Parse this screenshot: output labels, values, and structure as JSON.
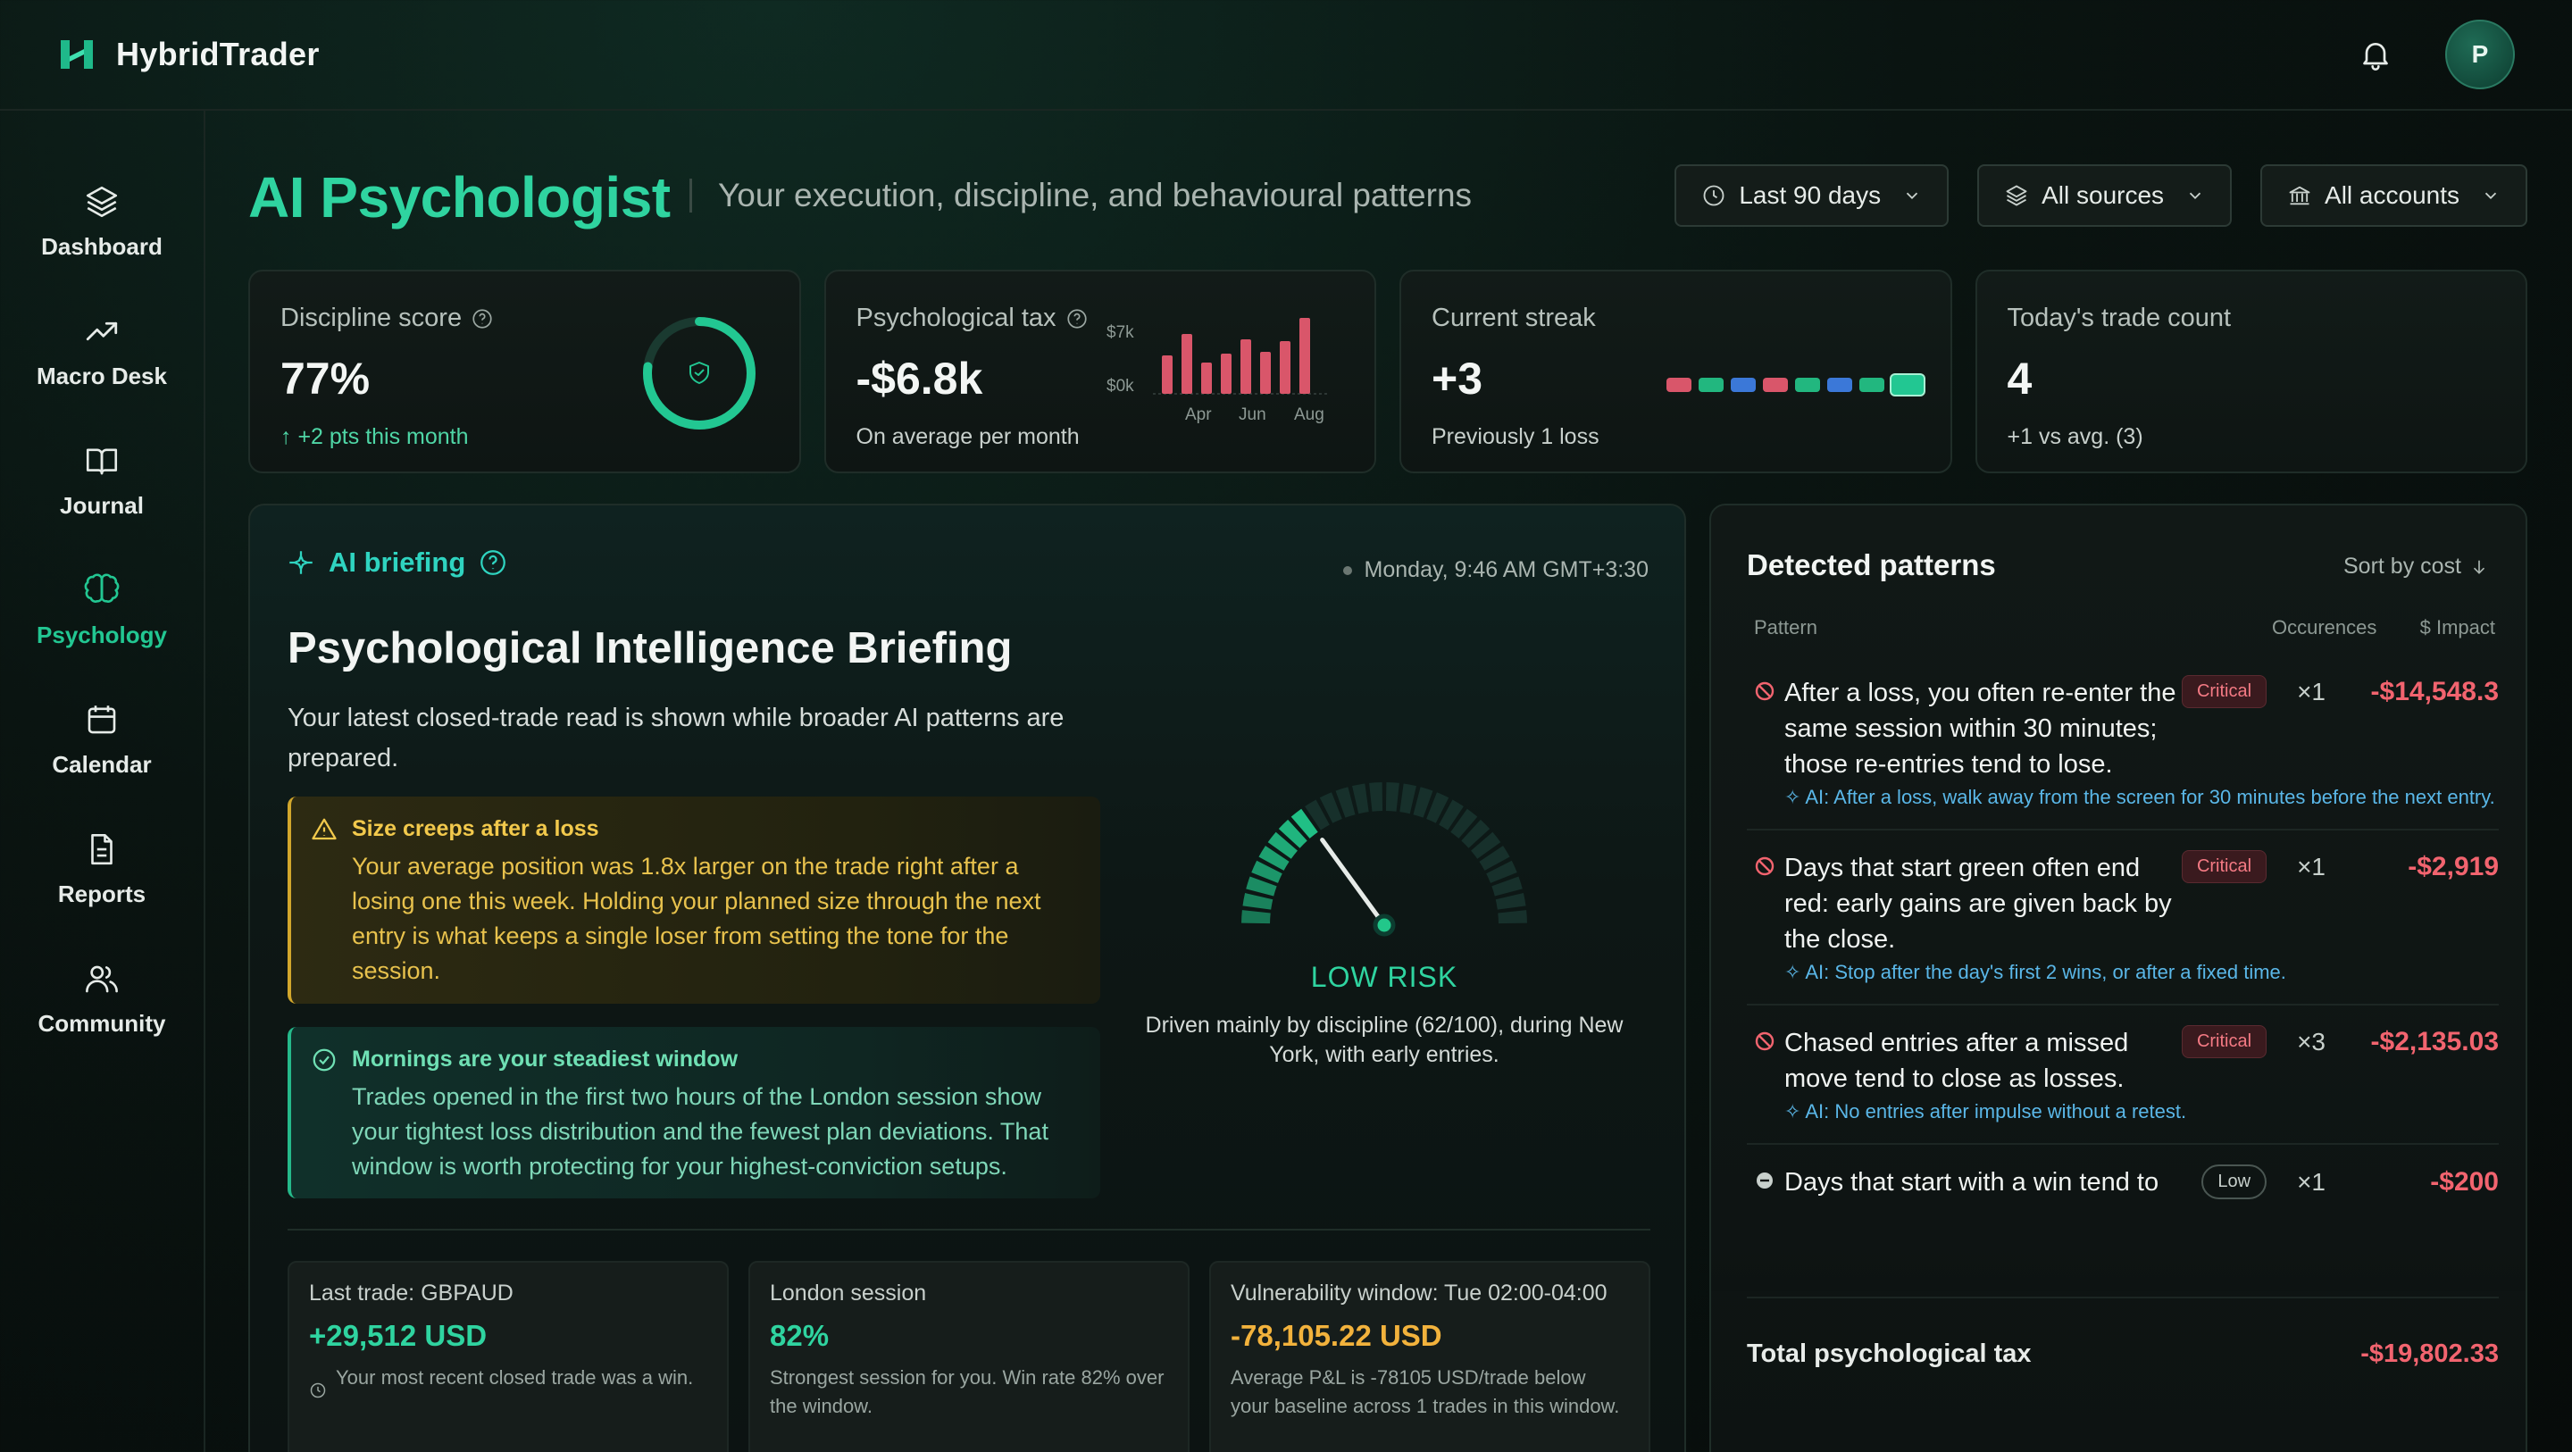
{
  "app": {
    "name": "HybridTrader",
    "avatar_initial": "P",
    "accent": "#2fd4a0"
  },
  "topbar": {
    "icons": [
      "bell-icon"
    ]
  },
  "sidebar": {
    "items": [
      {
        "label": "Dashboard",
        "icon": "layers-icon"
      },
      {
        "label": "Macro Desk",
        "icon": "trending-up-icon"
      },
      {
        "label": "Journal",
        "icon": "book-icon"
      },
      {
        "label": "Psychology",
        "icon": "brain-icon",
        "active": true
      },
      {
        "label": "Calendar",
        "icon": "calendar-icon"
      },
      {
        "label": "Reports",
        "icon": "file-icon"
      },
      {
        "label": "Community",
        "icon": "users-icon"
      }
    ]
  },
  "header": {
    "title": "AI Psychologist",
    "subtitle": "Your execution, discipline, and behavioural patterns",
    "filters": [
      {
        "label": "Last 90 days",
        "icon": "clock-icon"
      },
      {
        "label": "All sources",
        "icon": "layers-icon"
      },
      {
        "label": "All accounts",
        "icon": "bank-icon"
      }
    ]
  },
  "kpis": {
    "discipline": {
      "label": "Discipline score",
      "value": "77%",
      "sub": "+2 pts this month",
      "score_fraction": 0.77
    },
    "tax": {
      "label": "Psychological tax",
      "value": "-$6.8k",
      "sub": "On average per month",
      "chart": {
        "y_labels": [
          "$7k",
          "$0k"
        ],
        "x_labels": [
          "Apr",
          "Jun",
          "Aug"
        ]
      }
    },
    "streak": {
      "label": "Current streak",
      "value": "+3",
      "sub": "Previously 1 loss",
      "colors": [
        "#d9566a",
        "#22b77f",
        "#3b78d8",
        "#d9566a",
        "#22b77f",
        "#3b78d8",
        "#22b77f",
        "#22c792"
      ]
    },
    "trades": {
      "label": "Today's trade count",
      "value": "4",
      "sub": "+1 vs avg. (3)"
    }
  },
  "briefing": {
    "tag": "AI briefing",
    "time": "Monday, 9:46 AM GMT+3:30",
    "title": "Psychological Intelligence Briefing",
    "description": "Your latest closed-trade read is shown while broader AI patterns are prepared.",
    "warning": {
      "title": "Size creeps after a loss",
      "body": "Your average position was 1.8x larger on the trade right after a losing one this week. Holding your planned size through the next entry is what keeps a single loser from setting the tone for the session."
    },
    "good": {
      "title": "Mornings are your steadiest window",
      "body": "Trades opened in the first two hours of the London session show your tightest loss distribution and the fewest plan deviations. That window is worth protecting for your highest-conviction setups."
    },
    "gauge": {
      "label": "LOW RISK",
      "description": "Driven mainly by discipline (62/100), during New York, with early entries.",
      "risk_fraction": 0.3
    },
    "minis": [
      {
        "label": "Last trade: GBPAUD",
        "value": "+29,512 USD",
        "note": "Your most recent closed trade was a win.",
        "tone": "green",
        "icon": true
      },
      {
        "label": "London session",
        "value": "82%",
        "note": "Strongest session for you. Win rate 82% over the window.",
        "tone": "green"
      },
      {
        "label": "Vulnerability window: Tue 02:00-04:00",
        "value": "-78,105.22 USD",
        "note": "Average P&L is -78105 USD/trade below your baseline across 1 trades in this window.",
        "tone": "amber"
      }
    ]
  },
  "patterns": {
    "title": "Detected patterns",
    "sort_label": "Sort by cost",
    "columns": {
      "pattern": "Pattern",
      "occurrences": "Occurences",
      "impact": "$ Impact"
    },
    "rows": [
      {
        "text": "After a loss, you often re-enter the same session within 30 minutes; those re-entries tend to lose.",
        "ai": "AI: After a loss, walk away from the screen for 30 minutes before the next entry.",
        "badge": "Critical",
        "occ": "×1",
        "impact": "-$14,548.3"
      },
      {
        "text": "Days that start green often end red: early gains are given back by the close.",
        "ai": "AI: Stop after the day's first 2 wins, or after a fixed time.",
        "badge": "Critical",
        "occ": "×1",
        "impact": "-$2,919"
      },
      {
        "text": "Chased entries after a missed move tend to close as losses.",
        "ai": "AI: No entries after impulse without a retest.",
        "badge": "Critical",
        "occ": "×3",
        "impact": "-$2,135.03"
      },
      {
        "text": "Days that start with a win tend to",
        "ai": "",
        "badge": "Low",
        "occ": "×1",
        "impact": "-$200"
      }
    ],
    "total_label": "Total psychological tax",
    "total_value": "-$19,802.33"
  }
}
